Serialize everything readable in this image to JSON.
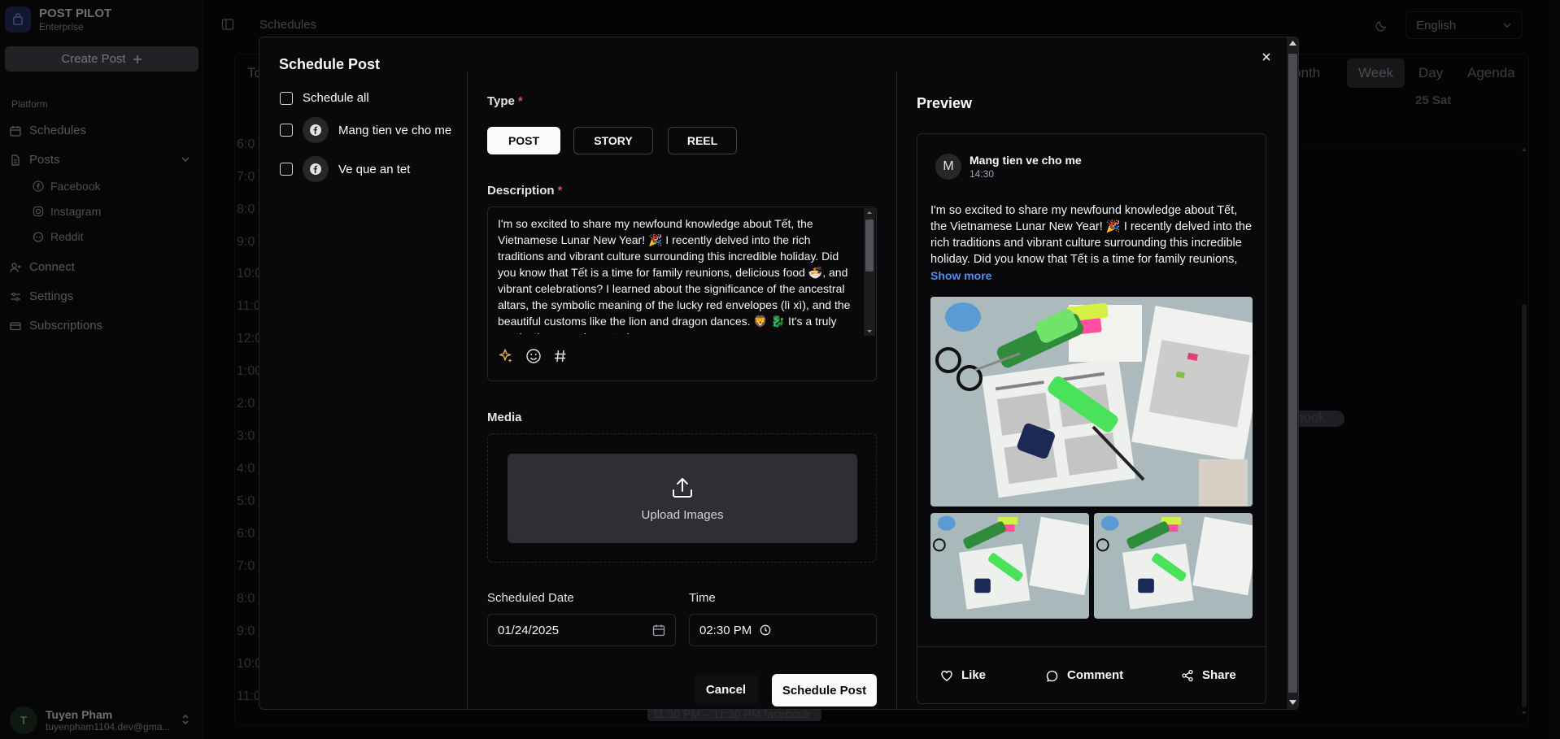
{
  "brand": {
    "name": "POST PILOT",
    "plan": "Enterprise"
  },
  "sidebar": {
    "create_post": "Create Post",
    "section": "Platform",
    "items": [
      {
        "label": "Schedules",
        "icon": "calendar-icon"
      },
      {
        "label": "Posts",
        "icon": "file-icon"
      },
      {
        "label": "Connect",
        "icon": "user-plus-icon"
      },
      {
        "label": "Settings",
        "icon": "sliders-icon"
      },
      {
        "label": "Subscriptions",
        "icon": "card-icon"
      }
    ],
    "sub_items": [
      {
        "label": "Facebook",
        "icon": "facebook-icon"
      },
      {
        "label": "Instagram",
        "icon": "instagram-icon"
      },
      {
        "label": "Reddit",
        "icon": "reddit-icon"
      }
    ],
    "user": {
      "initial": "T",
      "name": "Tuyen Pham",
      "email": "tuyenpham1104.dev@gma..."
    }
  },
  "topbar": {
    "title": "Schedules",
    "language": "English"
  },
  "calendar": {
    "views": [
      "Month",
      "Week",
      "Day",
      "Agenda"
    ],
    "active_view": "Week",
    "today_btn": "To",
    "day_header": "25 Sat",
    "hours": [
      "6:0",
      "7:0",
      "8:0",
      "9:0",
      "10:0",
      "11:0",
      "12:0",
      "1:00",
      "2:0",
      "3:0",
      "4:0",
      "5:0",
      "6:0",
      "7:0",
      "8:0",
      "9:0",
      "10:0",
      "11:0"
    ],
    "event_label": "book",
    "event_bottom": "11:30 PM – 11:30 PM facebook"
  },
  "dialog": {
    "title": "Schedule Post",
    "schedule_all": "Schedule all",
    "accounts": [
      {
        "name": "Mang tien ve cho me"
      },
      {
        "name": "Ve que an tet"
      }
    ],
    "type_label": "Type",
    "required_mark": "*",
    "types": [
      "POST",
      "STORY",
      "REEL"
    ],
    "selected_type": "POST",
    "description_label": "Description",
    "description": "I'm so excited to share my newfound knowledge about Tết, the Vietnamese Lunar New Year! 🎉  I recently delved into the rich traditions and vibrant culture surrounding this incredible holiday. Did you know that Tết is a time for family reunions, delicious food 🍜, and vibrant celebrations?  I learned about the significance of the ancestral altars, the symbolic meaning of the lucky red envelopes (lì xì), and the beautiful customs like the lion and dragon dances. 🦁 🐉  It's a truly captivating experience to learn",
    "media_label": "Media",
    "upload_label": "Upload Images",
    "date_label": "Scheduled Date",
    "date_value": "01/24/2025",
    "time_label": "Time",
    "time_value": "02:30 PM",
    "cancel": "Cancel",
    "submit": "Schedule Post"
  },
  "preview": {
    "title": "Preview",
    "avatar": "M",
    "account": "Mang tien ve cho me",
    "time": "14:30",
    "text": "I'm so excited to share my newfound knowledge about Tết, the Vietnamese Lunar New Year! 🎉  I recently delved into the rich traditions and vibrant culture surrounding this incredible holiday. Did you know that Tết is a time for family reunions, delicious food 🍜, and ...",
    "show_more": "Show more",
    "actions": [
      "Like",
      "Comment",
      "Share"
    ]
  },
  "colors": {
    "accent": "#fafafa",
    "link": "#4f8ff7",
    "required": "#e5484d",
    "background": "#09090b"
  }
}
